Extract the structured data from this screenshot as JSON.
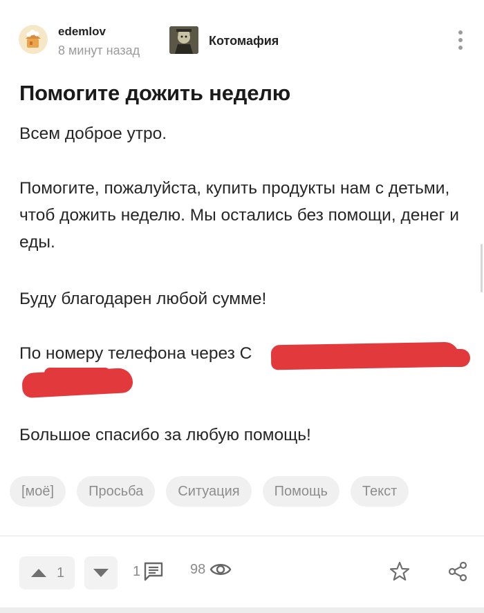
{
  "post": {
    "author": "edemlov",
    "time_ago": "8 минут назад",
    "community": "Котомафия",
    "title": "Помогите дожить неделю",
    "paragraphs": [
      "Всем доброе утро.",
      "Помогите, пожалуйста, купить продукты нам с детьми, чтоб дожить неделю. Мы остались без помощи, денег и еды.",
      "Буду благодарен любой сумме!",
      "По номеру телефона через С",
      "Большое спасибо за любую помощь!"
    ],
    "tags": [
      "[моё]",
      "Просьба",
      "Ситуация",
      "Помощь",
      "Текст"
    ]
  },
  "footer": {
    "rating": "1",
    "comments": "1",
    "views": "98"
  },
  "icons": {
    "menu": "more-vertical-icon",
    "upvote": "arrow-up-icon",
    "downvote": "arrow-down-icon",
    "comments": "comment-icon",
    "views": "eye-icon",
    "save": "star-icon",
    "share": "share-icon"
  },
  "colors": {
    "redaction": "#e23a3c",
    "tag_bg": "#f0f0f0",
    "muted": "#9a9a9a"
  }
}
